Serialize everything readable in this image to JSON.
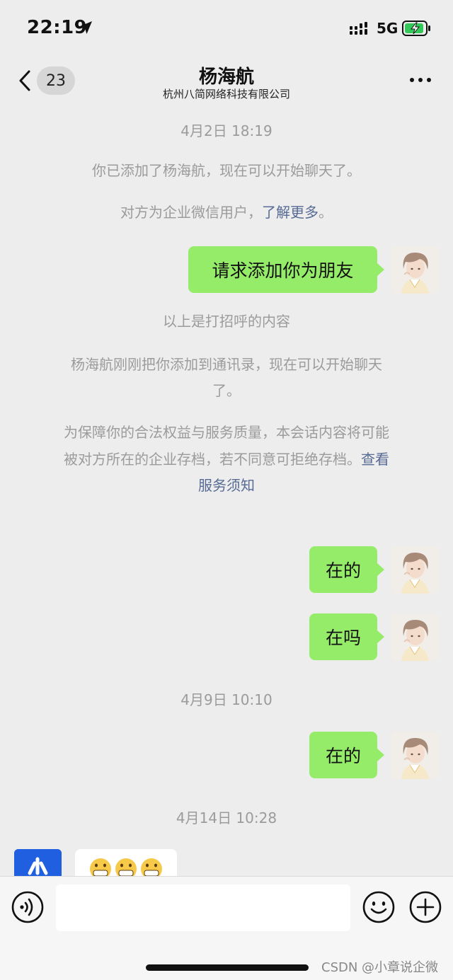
{
  "status_bar": {
    "time": "22:19",
    "network": "5G",
    "icons": [
      "location-arrow-icon",
      "signal-icon",
      "battery-charging-icon"
    ]
  },
  "header": {
    "unread_count": "23",
    "contact_name": "杨海航",
    "company": "杭州八简网络科技有限公司",
    "icons": [
      "back-chevron-icon",
      "more-options-icon"
    ]
  },
  "chat": {
    "time_1": "4月2日 18:19",
    "notice_added": "你已添加了杨海航，现在可以开始聊天了。",
    "notice_wecom_prefix": "对方为企业微信用户，",
    "notice_wecom_link": "了解更多",
    "notice_wecom_suffix": "。",
    "msg_request": "请求添加你为朋友",
    "notice_greeting": "以上是打招呼的内容",
    "notice_contact_line1": "杨海航刚刚把你添加到通讯录，现在可以开始聊天",
    "notice_contact_line2": "了。",
    "notice_archive_line1": "为保障你的合法权益与服务质量，本会话内容将可能",
    "notice_archive_line2": "被对方所在的企业存档，若不同意可拒绝存档。",
    "notice_archive_link_a": "查看",
    "notice_archive_link_b": "服务须知",
    "msg_1": "在的",
    "msg_2": "在吗",
    "time_2": "4月9日 10:10",
    "msg_3": "在的",
    "time_3": "4月14日 10:28",
    "incoming_emoji_count": 3
  },
  "input_bar": {
    "placeholder": "",
    "icons": [
      "voice-icon",
      "emoji-icon",
      "plus-icon"
    ]
  },
  "watermark": "CSDN @小章说企微",
  "colors": {
    "background": "#ededed",
    "outgoing_bubble": "#95ec69",
    "link": "#576b95",
    "system_text": "#9b9b9b"
  }
}
